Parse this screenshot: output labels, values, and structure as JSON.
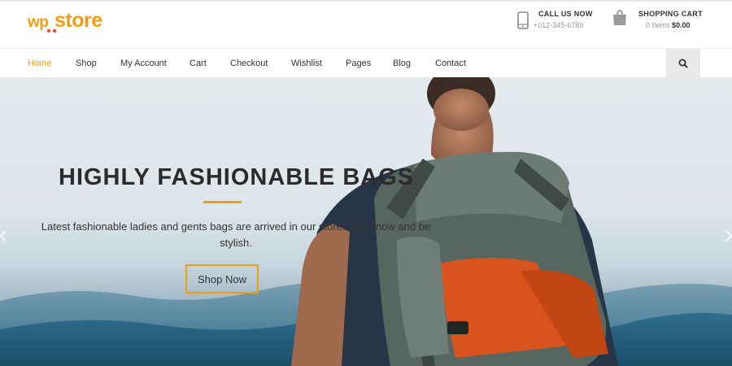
{
  "brand": {
    "logo_wp": "wp",
    "logo_store": "store",
    "accent_color": "#f39c12"
  },
  "contact": {
    "title": "CALL US NOW",
    "phone": "+012-345-6789",
    "icon": "phone-icon"
  },
  "cart": {
    "title": "SHOPPING CART",
    "items_text": "0 Items",
    "total": "$0.00",
    "icon": "shopping-bag-icon"
  },
  "nav": {
    "items": [
      {
        "label": "Home",
        "active": true
      },
      {
        "label": "Shop"
      },
      {
        "label": "My Account"
      },
      {
        "label": "Cart"
      },
      {
        "label": "Checkout"
      },
      {
        "label": "Wishlist"
      },
      {
        "label": "Pages"
      },
      {
        "label": "Blog"
      },
      {
        "label": "Contact"
      }
    ],
    "search_icon": "search-icon"
  },
  "hero": {
    "title": "HIGHLY FASHIONABLE BAGS",
    "description": "Latest fashionable ladies and gents bags are arrived in our store. Shop now and be stylish.",
    "button_label": "Shop Now"
  }
}
